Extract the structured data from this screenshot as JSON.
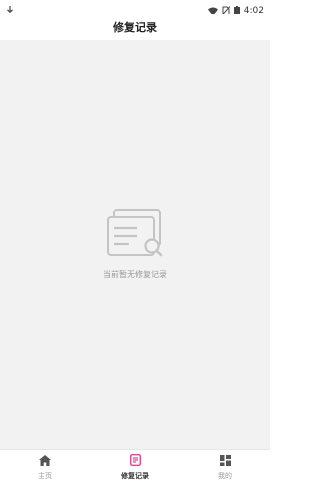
{
  "status_bar": {
    "time": "4:02"
  },
  "header": {
    "title": "修复记录"
  },
  "empty_state": {
    "message": "当前暂无修复记录"
  },
  "tabs": [
    {
      "label": "主页",
      "icon": "home-icon",
      "active": false
    },
    {
      "label": "修复记录",
      "icon": "record-icon",
      "active": true
    },
    {
      "label": "我的",
      "icon": "grid-icon",
      "active": false
    }
  ],
  "colors": {
    "accent": "#e0468c",
    "inactive": "#999999",
    "background": "#f2f2f2"
  }
}
